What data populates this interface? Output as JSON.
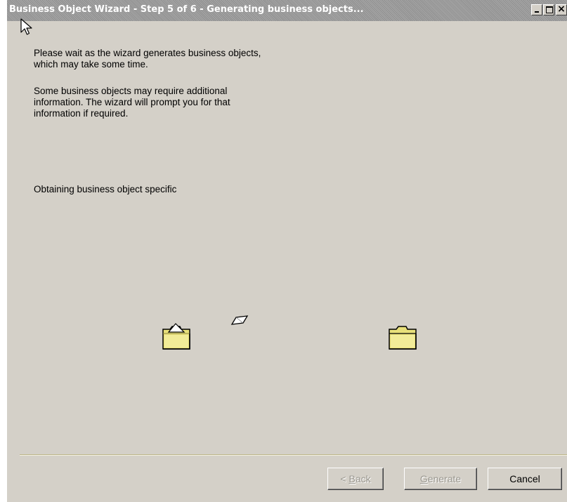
{
  "window": {
    "title": "Business Object Wizard - Step 5 of 6 - Generating business objects..."
  },
  "title_controls": {
    "minimize_icon": "minimize-icon",
    "maximize_icon": "maximize-icon",
    "close_icon": "close-icon",
    "close_glyph": "×"
  },
  "content": {
    "paragraph1": "Please wait as the wizard generates business objects,\nwhich may take some time.",
    "paragraph2": "     Some business objects may require additional\ninformation. The wizard will prompt you for that\ninformation if required.",
    "status_text": "Obtaining business object specific"
  },
  "animation": {
    "source_icon": "folder-icon",
    "document_icon": "document-icon",
    "destination_icon": "folder-icon"
  },
  "buttons": {
    "back": {
      "prefix": "< ",
      "mnemonic": "B",
      "rest": "ack",
      "enabled": false
    },
    "generate": {
      "mnemonic": "G",
      "rest": "enerate",
      "enabled": false
    },
    "cancel": {
      "label": "Cancel",
      "enabled": true
    }
  },
  "colors": {
    "window_bg": "#d4d0c8",
    "titlebar_inactive": "#a0a0a0",
    "folder_yellow": "#e8e07a"
  }
}
